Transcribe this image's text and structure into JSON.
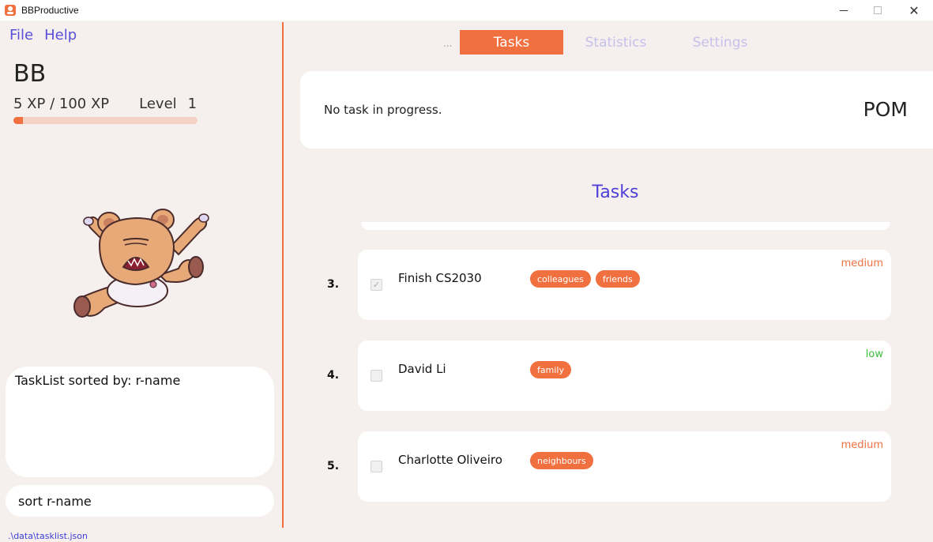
{
  "window": {
    "title": "BBProductive",
    "controls": {
      "close": "✕"
    }
  },
  "menu": {
    "file": "File",
    "help": "Help"
  },
  "user": {
    "name": "BB",
    "xp_text": "5 XP / 100 XP",
    "level_label": "Level",
    "level_value": "1",
    "xp_progress": 0.05
  },
  "response": {
    "text": "TaskList sorted by: r-name"
  },
  "command": {
    "value": "sort r-name"
  },
  "status": {
    "path": ".\\data\\tasklist.json"
  },
  "tabs": {
    "ellipsis": "...",
    "items": [
      {
        "label": "Tasks",
        "active": true
      },
      {
        "label": "Statistics",
        "active": false
      },
      {
        "label": "Settings",
        "active": false
      }
    ]
  },
  "pomodoro": {
    "status_text": "No task in progress.",
    "label": "POM"
  },
  "tasks_section": {
    "title": "Tasks"
  },
  "tasks": [
    {
      "index": "3.",
      "name": "Finish CS2030",
      "tags": [
        "colleagues",
        "friends"
      ],
      "priority": "medium",
      "done": true,
      "check_mark": "✓"
    },
    {
      "index": "4.",
      "name": "David Li",
      "tags": [
        "family"
      ],
      "priority": "low",
      "done": false
    },
    {
      "index": "5.",
      "name": "Charlotte Oliveiro",
      "tags": [
        "neighbours"
      ],
      "priority": "medium",
      "done": false
    }
  ],
  "colors": {
    "accent": "#f07040",
    "menu_text": "#5a4fd8",
    "title_purple": "#4e3fd8",
    "priority_medium": "#f07040",
    "priority_low": "#3cbf3c",
    "background": "#f5f0ee"
  },
  "icons": {
    "app": "app-logo-icon",
    "minimize": "minimize-icon",
    "maximize": "maximize-icon",
    "close": "close-icon",
    "mascot": "bear-mascot-icon",
    "checkbox": "checkbox-icon"
  }
}
